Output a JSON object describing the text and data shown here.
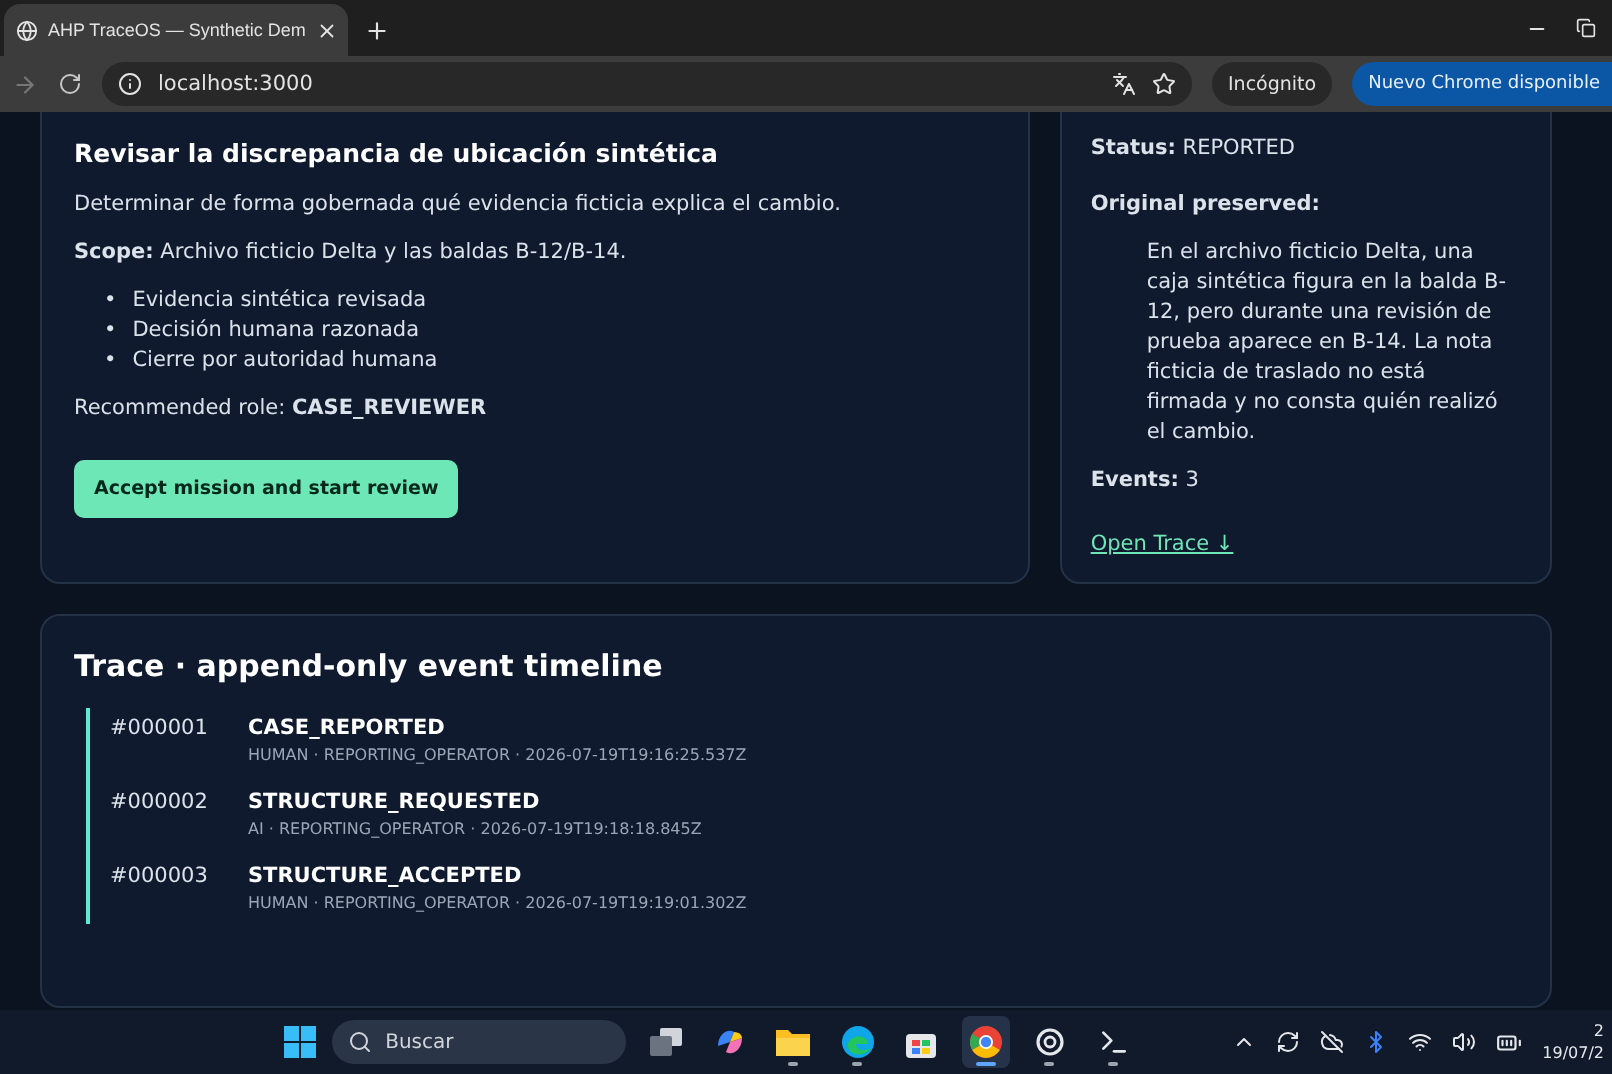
{
  "browser": {
    "tab": {
      "title": "AHP TraceOS — Synthetic Dem",
      "selected": true
    },
    "address": "localhost:3000",
    "incognito": "Incógnito",
    "update_button": "Nuevo Chrome disponible"
  },
  "mission": {
    "title": "Revisar la discrepancia de ubicación sintética",
    "description": "Determinar de forma gobernada qué evidencia ficticia explica el cambio.",
    "scope": "**Scope:** Archivo ficticio Delta y las baldas B-12/B-14.",
    "bullet": "•",
    "criteria": [
      "Evidencia sintética revisada",
      "Decisión humana razonada",
      "Cierre por autoridad humana"
    ],
    "role": "Recommended role: **CASE_REVIEWER**",
    "button": "Accept mission and start review"
  },
  "case": {
    "status": "**Status:** REPORTED",
    "original_label": "Original preserved:",
    "original_text": "En el archivo ficticio Delta, una caja sintética figura en la balda B-12, pero durante una revisión de prueba aparece en B-14. La nota ficticia de traslado no está firmada y no consta quién realizó el cambio.",
    "events": "**Events:** 3",
    "link": "Open Trace ↓"
  },
  "trace": {
    "title": "Trace · append-only event timeline",
    "events": [
      {
        "seq": "#000001",
        "type": "CASE_REPORTED",
        "meta": "HUMAN · REPORTING_OPERATOR · 2026-07-19T19:16:25.537Z"
      },
      {
        "seq": "#000002",
        "type": "STRUCTURE_REQUESTED",
        "meta": "AI · REPORTING_OPERATOR · 2026-07-19T19:18:18.845Z"
      },
      {
        "seq": "#000003",
        "type": "STRUCTURE_ACCEPTED",
        "meta": "HUMAN · REPORTING_OPERATOR · 2026-07-19T19:19:01.302Z"
      }
    ]
  },
  "taskbar": {
    "search": "Buscar",
    "apps": [
      {
        "kind": "taskview",
        "active": false
      },
      {
        "kind": "copilot",
        "active": false
      },
      {
        "kind": "folder",
        "active": true
      },
      {
        "kind": "edge",
        "active": true
      },
      {
        "kind": "store",
        "active": false
      },
      {
        "kind": "chrome",
        "active": true
      },
      {
        "kind": "openai",
        "active": true
      },
      {
        "kind": "terminal",
        "active": true
      }
    ],
    "time": "2",
    "date": "19/07/2"
  }
}
